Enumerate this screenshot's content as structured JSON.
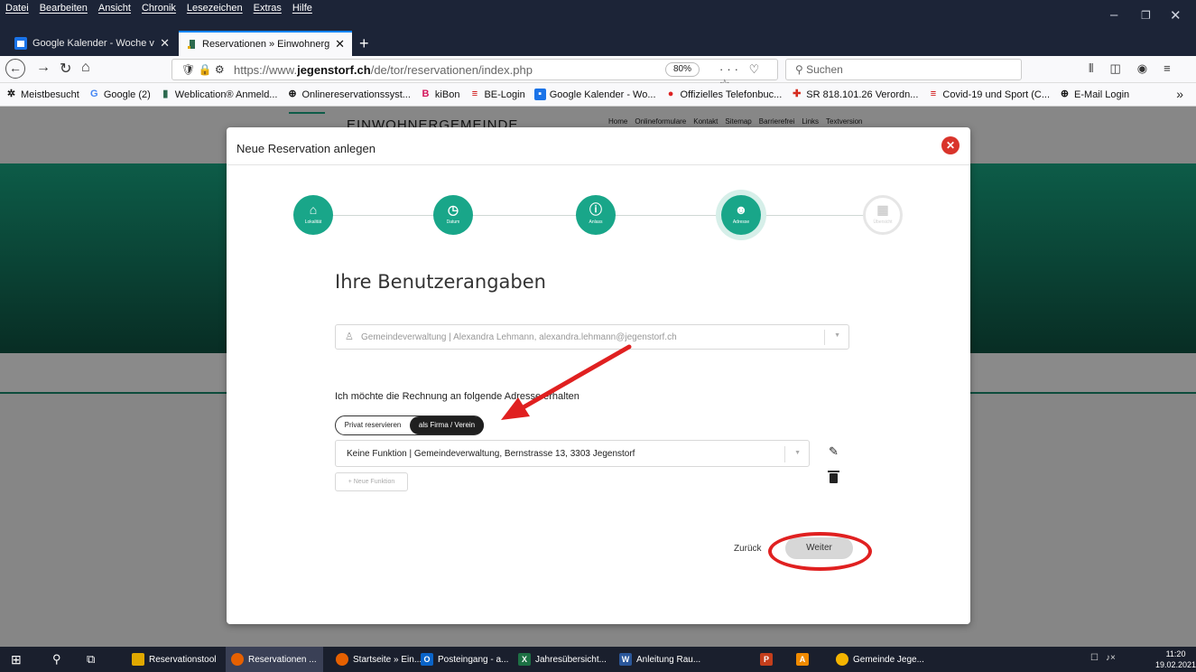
{
  "menubar": {
    "items": [
      "Datei",
      "Bearbeiten",
      "Ansicht",
      "Chronik",
      "Lesezeichen",
      "Extras",
      "Hilfe"
    ]
  },
  "tabs": [
    {
      "label": "Google Kalender - Woche vom",
      "icon": "calendar-icon"
    },
    {
      "label": "Reservationen » Einwohnergem",
      "icon": "jegenstorf-icon",
      "active": true
    }
  ],
  "navbar": {
    "url_prefix": "https://www.",
    "url_domain": "jegenstorf.ch",
    "url_path": "/de/tor/reservationen/index.php",
    "zoom": "80%",
    "search_placeholder": "Suchen"
  },
  "bookmarks": [
    {
      "label": "Meistbesucht",
      "icon": "gear-icon"
    },
    {
      "label": "Google (2)",
      "icon": "google-icon"
    },
    {
      "label": "Weblication® Anmeld...",
      "icon": "jegenstorf-icon"
    },
    {
      "label": "Onlinereservationssyst...",
      "icon": "globe-icon"
    },
    {
      "label": "kiBon",
      "icon": "kibon-icon"
    },
    {
      "label": "BE-Login",
      "icon": "be-icon"
    },
    {
      "label": "Google Kalender - Wo...",
      "icon": "calendar-icon"
    },
    {
      "label": "Offizielles Telefonbuc...",
      "icon": "location-icon"
    },
    {
      "label": "SR 818.101.26 Verordn...",
      "icon": "swiss-icon"
    },
    {
      "label": "Covid-19 und Sport (C...",
      "icon": "be-icon"
    },
    {
      "label": "E-Mail Login",
      "icon": "globe-icon"
    }
  ],
  "background_page": {
    "brand": "EINWOHNERGEMEINDE",
    "nav": [
      "Home",
      "Onlineformulare",
      "Kontakt",
      "Sitemap",
      "Barrierefrei",
      "Links",
      "Textversion"
    ]
  },
  "modal": {
    "title": "Neue Reservation anlegen",
    "steps": [
      {
        "label": "Lokalität",
        "icon": "home-icon",
        "state": "done"
      },
      {
        "label": "Datum",
        "icon": "clock-icon",
        "state": "done"
      },
      {
        "label": "Anlass",
        "icon": "info-icon",
        "state": "done"
      },
      {
        "label": "Adresse",
        "icon": "user-icon",
        "state": "current"
      },
      {
        "label": "Übersicht",
        "icon": "calendar-check-icon",
        "state": "todo"
      }
    ],
    "heading": "Ihre Benutzerangaben",
    "user_select": "Gemeindeverwaltung | Alexandra Lehmann, alexandra.lehmann@jegenstorf.ch",
    "bill_text": "Ich möchte die Rechnung an folgende Adresse erhalten",
    "toggle": {
      "private": "Privat reservieren",
      "company": "als Firma / Verein",
      "selected": "company"
    },
    "function_select": "Keine Funktion | Gemeindeverwaltung, Bernstrasse 13, 3303 Jegenstorf",
    "new_function": "+ Neue Funktion",
    "back": "Zurück",
    "next": "Weiter"
  },
  "taskbar": {
    "items": [
      {
        "label": "Reservationstool",
        "color": "#e0a800"
      },
      {
        "label": "Reservationen ...",
        "color": "#e66000",
        "active": true
      },
      {
        "label": "Startseite » Ein...",
        "color": "#e66000"
      },
      {
        "label": "Posteingang - a...",
        "color": "#0a64c8"
      },
      {
        "label": "Jahresübersicht...",
        "color": "#1d7044"
      },
      {
        "label": "Anleitung Rau...",
        "color": "#2b579a"
      },
      {
        "label": "",
        "color": "#c43e1c"
      },
      {
        "label": "",
        "color": "#f08a00"
      },
      {
        "label": "Gemeinde Jege...",
        "color": "#f4b400"
      }
    ],
    "time": "11:20",
    "date": "19.02.2021"
  },
  "colors": {
    "accent": "#19a689",
    "close": "#d9342b",
    "annotation": "#e02020"
  }
}
